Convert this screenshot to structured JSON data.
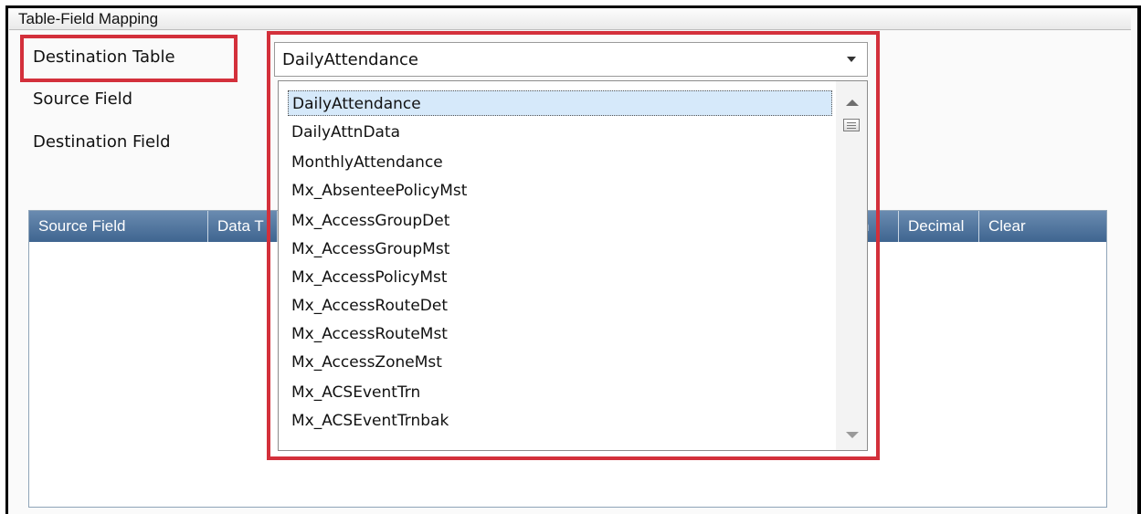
{
  "group": {
    "title": "Table-Field Mapping"
  },
  "labels": {
    "destination_table": "Destination Table",
    "source_field": "Source Field",
    "destination_field": "Destination Field"
  },
  "combo": {
    "selected": "DailyAttendance",
    "options": [
      "DailyAttendance",
      "DailyAttnData",
      "MonthlyAttendance",
      "Mx_AbsenteePolicyMst",
      "Mx_AccessGroupDet",
      "Mx_AccessGroupMst",
      "Mx_AccessPolicyMst",
      "Mx_AccessRouteDet",
      "Mx_AccessRouteMst",
      "Mx_AccessZoneMst",
      "Mx_ACSEventTrn",
      "Mx_ACSEventTrnbak"
    ]
  },
  "grid": {
    "columns": [
      "Source Field",
      "Data T",
      "h",
      "Decimal",
      "Clear"
    ]
  },
  "colors": {
    "highlight_border": "#d3303b",
    "grid_header": "#4f739b",
    "selected_item_bg": "#d6e9fa"
  },
  "icons": {
    "combo_arrow": "chevron-down-icon",
    "scroll_up": "scroll-up-arrow-icon",
    "scroll_down": "scroll-down-arrow-icon",
    "scroll_thumb": "scroll-thumb-grip-icon"
  }
}
